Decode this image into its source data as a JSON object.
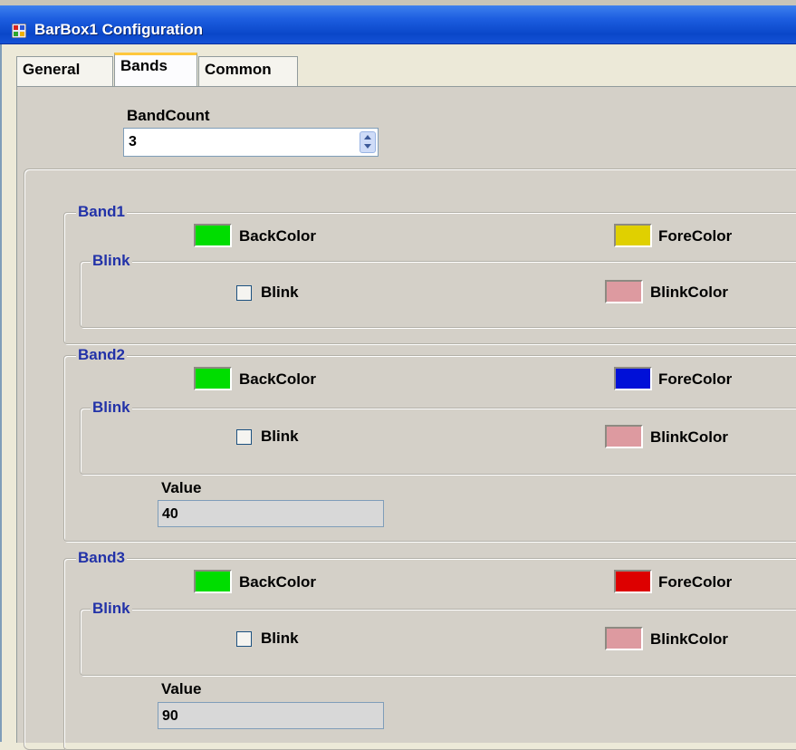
{
  "window": {
    "title": "BarBox1 Configuration"
  },
  "tabs": [
    {
      "label": "General"
    },
    {
      "label": "Bands"
    },
    {
      "label": "Common"
    }
  ],
  "band_count": {
    "label": "BandCount",
    "value": "3"
  },
  "bands": [
    {
      "title": "Band1",
      "back_color_label": "BackColor",
      "back_color": "#00dd00",
      "fore_color_label": "ForeColor",
      "fore_color": "#e0d000",
      "blink_group_title": "Blink",
      "blink_checkbox_label": "Blink",
      "blink_checked": false,
      "blink_color_label": "BlinkColor",
      "blink_color": "#dd9aa0"
    },
    {
      "title": "Band2",
      "back_color_label": "BackColor",
      "back_color": "#00dd00",
      "fore_color_label": "ForeColor",
      "fore_color": "#0010d8",
      "blink_group_title": "Blink",
      "blink_checkbox_label": "Blink",
      "blink_checked": false,
      "blink_color_label": "BlinkColor",
      "blink_color": "#dd9aa0",
      "value_label": "Value",
      "value": "40"
    },
    {
      "title": "Band3",
      "back_color_label": "BackColor",
      "back_color": "#00dd00",
      "fore_color_label": "ForeColor",
      "fore_color": "#dd0000",
      "blink_group_title": "Blink",
      "blink_checkbox_label": "Blink",
      "blink_checked": false,
      "blink_color_label": "BlinkColor",
      "blink_color": "#dd9aa0",
      "value_label": "Value",
      "value": "90"
    }
  ]
}
